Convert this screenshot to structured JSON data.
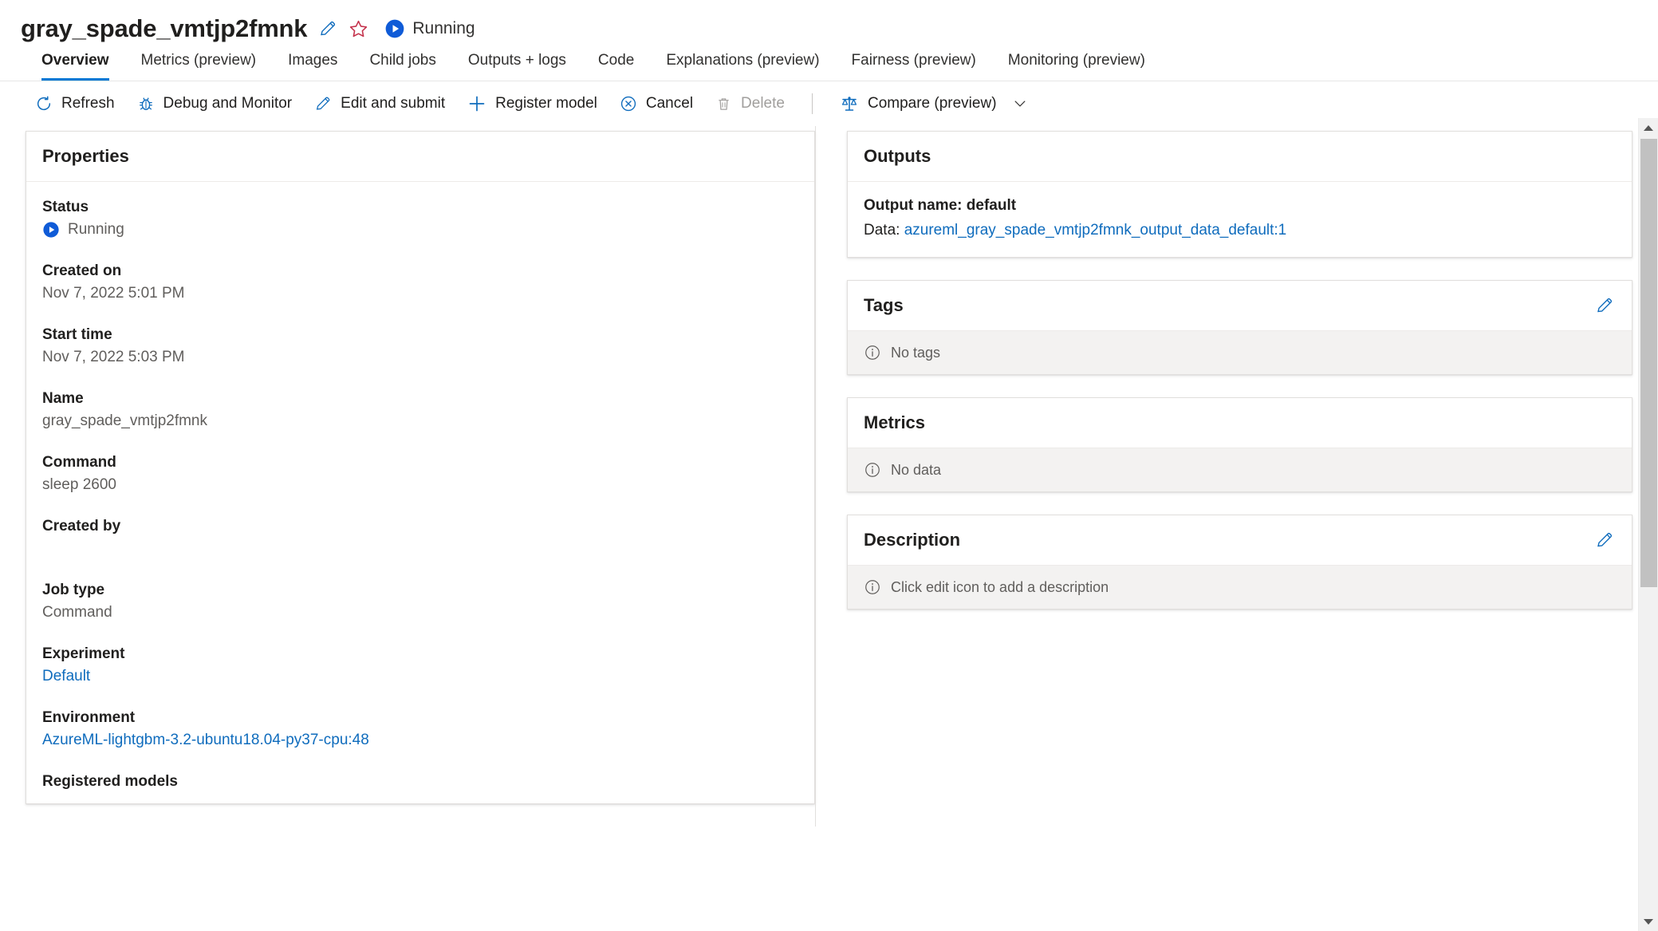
{
  "header": {
    "job_title": "gray_spade_vmtjp2fmnk",
    "edit_icon": "pencil-icon",
    "favorite_icon": "star-icon",
    "status_icon": "running-play-icon",
    "status_text": "Running"
  },
  "tabs": [
    {
      "label": "Overview",
      "active": true
    },
    {
      "label": "Metrics (preview)",
      "active": false
    },
    {
      "label": "Images",
      "active": false
    },
    {
      "label": "Child jobs",
      "active": false
    },
    {
      "label": "Outputs + logs",
      "active": false
    },
    {
      "label": "Code",
      "active": false
    },
    {
      "label": "Explanations (preview)",
      "active": false
    },
    {
      "label": "Fairness (preview)",
      "active": false
    },
    {
      "label": "Monitoring (preview)",
      "active": false
    }
  ],
  "commandbar": {
    "refresh": "Refresh",
    "debug_and_monitor": "Debug and Monitor",
    "edit_and_submit": "Edit and submit",
    "register_model": "Register model",
    "cancel": "Cancel",
    "delete": "Delete",
    "compare": "Compare (preview)"
  },
  "annotation": {
    "highlight_color": "#e81123",
    "highlight_target": "Debug and Monitor"
  },
  "properties": {
    "title": "Properties",
    "items": [
      {
        "label": "Status",
        "value": "Running",
        "type": "status"
      },
      {
        "label": "Created on",
        "value": "Nov 7, 2022 5:01 PM",
        "type": "text"
      },
      {
        "label": "Start time",
        "value": "Nov 7, 2022 5:03 PM",
        "type": "text"
      },
      {
        "label": "Name",
        "value": "gray_spade_vmtjp2fmnk",
        "type": "text"
      },
      {
        "label": "Command",
        "value": "sleep 2600",
        "type": "text"
      },
      {
        "label": "Created by",
        "value": "",
        "type": "text"
      },
      {
        "label": "Job type",
        "value": "Command",
        "type": "text"
      },
      {
        "label": "Experiment",
        "value": "Default",
        "type": "link"
      },
      {
        "label": "Environment",
        "value": "AzureML-lightgbm-3.2-ubuntu18.04-py37-cpu:48",
        "type": "link"
      },
      {
        "label": "Registered models",
        "value": "",
        "type": "text"
      }
    ]
  },
  "outputs": {
    "title": "Outputs",
    "output_name_label": "Output name: default",
    "data_label": "Data:",
    "data_value": "azureml_gray_spade_vmtjp2fmnk_output_data_default:1"
  },
  "tags": {
    "title": "Tags",
    "edit_icon": "pencil-icon",
    "empty_text": "No tags"
  },
  "metrics": {
    "title": "Metrics",
    "empty_text": "No data"
  },
  "description": {
    "title": "Description",
    "edit_icon": "pencil-icon",
    "empty_text": "Click edit icon to add a description"
  },
  "colors": {
    "accent": "#0078d4",
    "link": "#0f6cbd",
    "annotation_red": "#e81123",
    "star_red": "#c4314b"
  }
}
